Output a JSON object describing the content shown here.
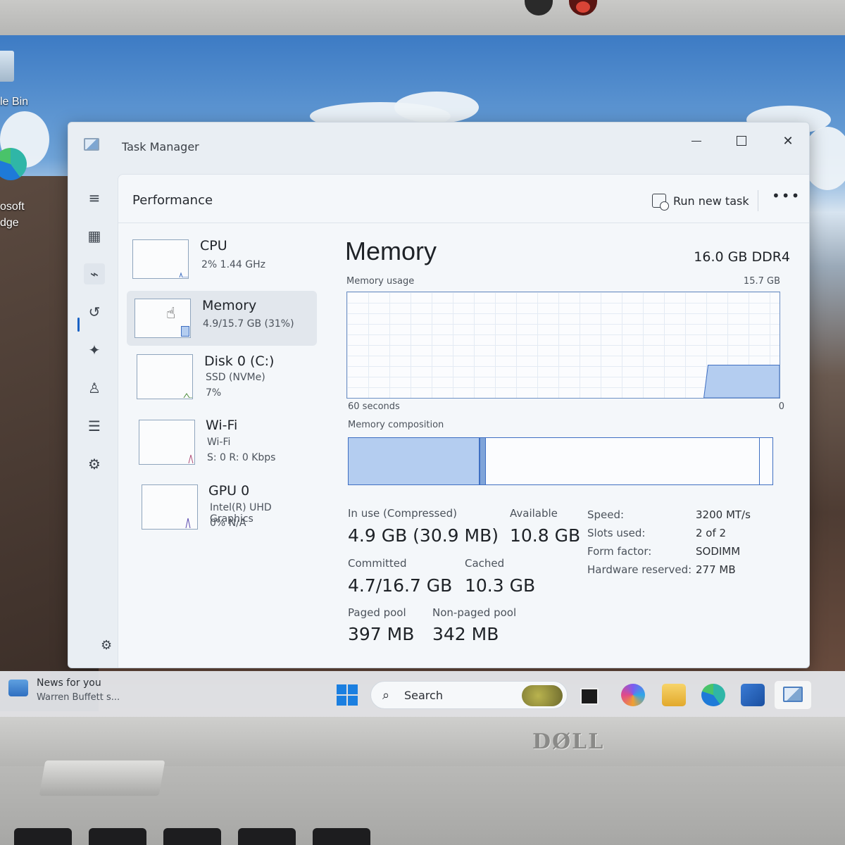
{
  "desktop": {
    "recycle_bin_label": "le Bin",
    "edge_label_1": "osoft",
    "edge_label_2": "dge"
  },
  "window": {
    "title": "Task Manager",
    "minimize_icon": "minimize-icon",
    "maximize_icon": "maximize-icon",
    "close_icon": "close-icon"
  },
  "nav": {
    "items": [
      {
        "name": "hamburger",
        "icon": "≡"
      },
      {
        "name": "processes",
        "icon": "▦"
      },
      {
        "name": "performance",
        "icon": "⌁"
      },
      {
        "name": "app-history",
        "icon": "↺"
      },
      {
        "name": "startup-apps",
        "icon": "✦"
      },
      {
        "name": "users",
        "icon": "♙"
      },
      {
        "name": "details",
        "icon": "☰"
      },
      {
        "name": "services",
        "icon": "⚙"
      }
    ],
    "settings_icon": "⚙"
  },
  "header": {
    "page_title": "Performance",
    "run_new_task": "Run new task",
    "more_label": "•••"
  },
  "resources": [
    {
      "name": "CPU",
      "line1": "2%  1.44 GHz",
      "line2": ""
    },
    {
      "name": "Memory",
      "line1": "4.9/15.7 GB (31%)",
      "line2": ""
    },
    {
      "name": "Disk 0 (C:)",
      "line1": "SSD (NVMe)",
      "line2": "7%"
    },
    {
      "name": "Wi-Fi",
      "line1": "Wi-Fi",
      "line2": "S: 0  R: 0 Kbps"
    },
    {
      "name": "GPU 0",
      "line1": "Intel(R) UHD Graphics",
      "line2": "0%  N/A"
    }
  ],
  "memory": {
    "title": "Memory",
    "spec": "16.0 GB DDR4",
    "usage_label": "Memory usage",
    "usage_max": "15.7 GB",
    "time_label": "60 seconds",
    "zero_label": "0",
    "usage_fraction": 0.31,
    "composition_label": "Memory composition",
    "composition_in_use_fraction": 0.31,
    "composition_standby_end_fraction": 0.97,
    "stats": {
      "in_use_label": "In use (Compressed)",
      "in_use_value": "4.9 GB (30.9 MB)",
      "available_label": "Available",
      "available_value": "10.8 GB",
      "committed_label": "Committed",
      "committed_value": "4.7/16.7 GB",
      "cached_label": "Cached",
      "cached_value": "10.3 GB",
      "paged_label": "Paged pool",
      "paged_value": "397 MB",
      "nonpaged_label": "Non-paged pool",
      "nonpaged_value": "342 MB"
    },
    "specs": [
      {
        "key": "Speed:",
        "value": "3200 MT/s"
      },
      {
        "key": "Slots used:",
        "value": "2 of 2"
      },
      {
        "key": "Form factor:",
        "value": "SODIMM"
      },
      {
        "key": "Hardware reserved:",
        "value": "277 MB"
      }
    ]
  },
  "taskbar": {
    "news_title": "News for you",
    "news_sub": "Warren Buffett s...",
    "search_placeholder": "Search",
    "search_icon": "⌕"
  },
  "hardware": {
    "brand": "DØLL"
  },
  "colors": {
    "accent": "#1a62c4",
    "graph_fill": "#b4cdf0",
    "graph_line": "#3f6fc2"
  }
}
